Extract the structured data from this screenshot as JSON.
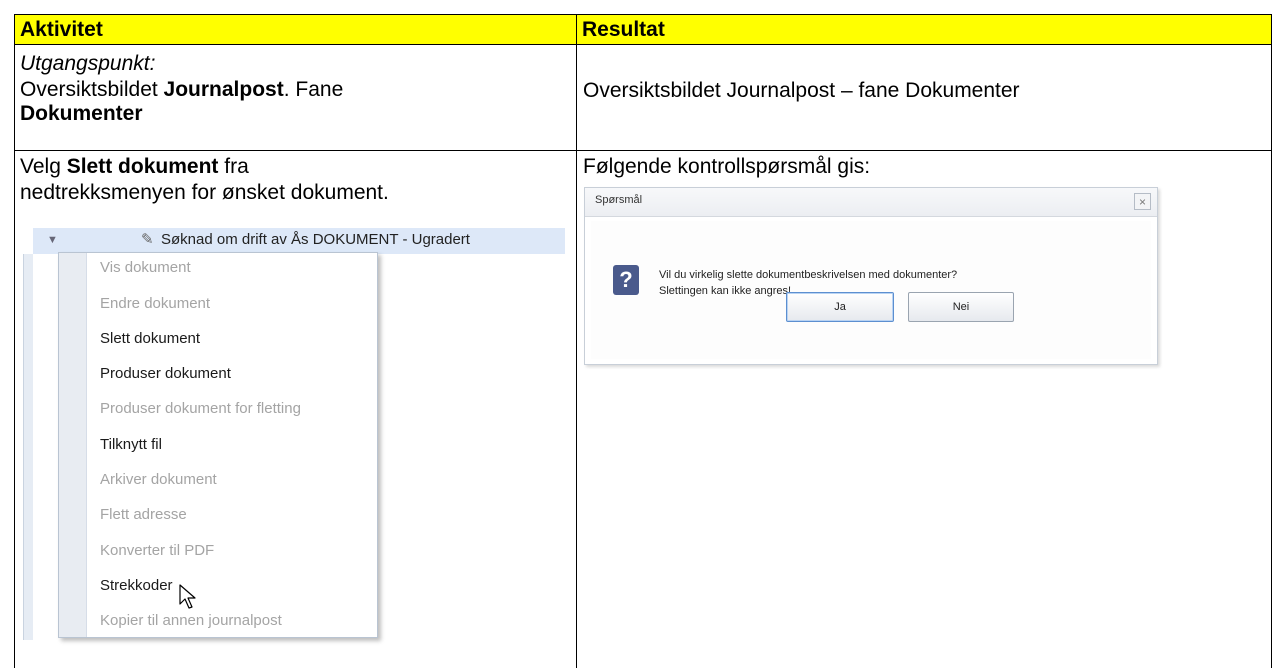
{
  "table": {
    "headers": [
      "Aktivitet",
      "Resultat"
    ],
    "row1": {
      "left_italic": "Utgangspunkt:",
      "left_line2_a": "Oversiktsbildet ",
      "left_line2_bold": "Journalpost",
      "left_line2_b": ". Fane",
      "left_line3_bold": "Dokumenter",
      "right": "Oversiktsbildet Journalpost – fane Dokumenter"
    },
    "row2": {
      "left_line1_a": "Velg ",
      "left_line1_bold": "Slett dokument",
      "left_line1_b": " fra",
      "left_line2": "nedtrekksmenyen for ønsket dokument.",
      "right": "Følgende kontrollspørsmål gis:"
    }
  },
  "context_menu": {
    "document_row": "Søknad om drift av Ås    DOKUMENT     - Ugradert",
    "items": [
      {
        "label": "Vis dokument",
        "enabled": false
      },
      {
        "label": "Endre dokument",
        "enabled": false
      },
      {
        "label": "Slett dokument",
        "enabled": true
      },
      {
        "label": "Produser dokument",
        "enabled": true
      },
      {
        "label": "Produser dokument for fletting",
        "enabled": false
      },
      {
        "label": "Tilknytt fil",
        "enabled": true
      },
      {
        "label": "Arkiver dokument",
        "enabled": false
      },
      {
        "label": "Flett adresse",
        "enabled": false
      },
      {
        "label": "Konverter til PDF",
        "enabled": false
      },
      {
        "label": "Strekkoder",
        "enabled": true
      },
      {
        "label": "Kopier til annen journalpost",
        "enabled": false
      }
    ]
  },
  "dialog": {
    "title": "Spørsmål",
    "message_line1": "Vil du virkelig slette dokumentbeskrivelsen med dokumenter?",
    "message_line2": "Slettingen kan ikke angres!",
    "yes_label": "Ja",
    "no_label": "Nei",
    "close_symbol": "×"
  },
  "colors": {
    "header_bg": "#ffff00",
    "row_highlight": "#dde8f8",
    "disabled_text": "#a4a4a4"
  }
}
